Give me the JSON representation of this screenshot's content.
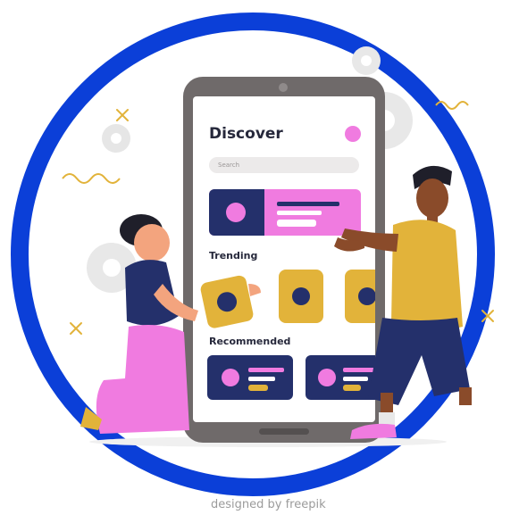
{
  "app": {
    "title": "Discover",
    "search_placeholder": "Search",
    "sections": {
      "trending": "Trending",
      "recommended": "Recommended"
    }
  },
  "watermark": "designed by freepik",
  "colors": {
    "ring": "#0b3fd8",
    "navy": "#24306b",
    "pink": "#f07be0",
    "mustard": "#e2b33a",
    "phone": "#6f6a6a"
  },
  "icons": [
    "gear-icon",
    "cross-icon",
    "wave-icon"
  ]
}
